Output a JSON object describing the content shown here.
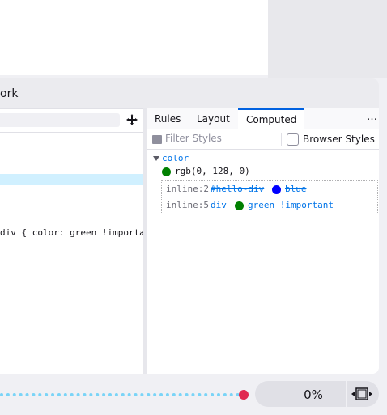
{
  "panel": {
    "title": "ork"
  },
  "left": {
    "code_line": "div { color: green !importa"
  },
  "tabs": [
    {
      "label": "Rules"
    },
    {
      "label": "Layout"
    },
    {
      "label": "Computed",
      "active": true
    }
  ],
  "more_label": "…",
  "filter": {
    "placeholder": "Filter Styles"
  },
  "browser_styles": {
    "label": "Browser Styles",
    "checked": false
  },
  "property": {
    "name": "color",
    "value": "rgb(0, 128, 0)",
    "swatch_color": "#008000"
  },
  "matches": [
    {
      "source": "inline:2",
      "selector": "#hello-div",
      "value": "blue",
      "swatch_color": "#0000ff",
      "overridden": true
    },
    {
      "source": "inline:5",
      "selector": "div",
      "value": "green !important",
      "swatch_color": "#008000",
      "overridden": false
    }
  ],
  "bottom": {
    "progress_percent": 100,
    "percent_label": "0%"
  },
  "colors": {
    "accent": "#0061e0",
    "selected_row": "#d0f0ff",
    "thumb": "#e02950",
    "track": "#7ad4f7"
  }
}
